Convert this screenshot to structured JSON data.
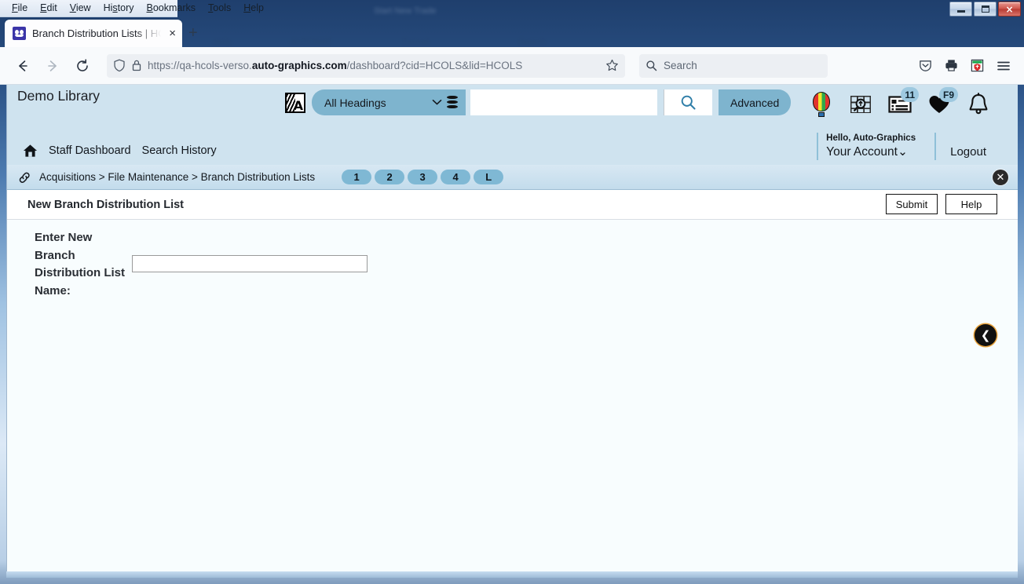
{
  "browser": {
    "menus": [
      "File",
      "Edit",
      "View",
      "History",
      "Bookmarks",
      "Tools",
      "Help"
    ],
    "window_controls": {
      "minimize": "minimize-button",
      "maximize": "maximize-button",
      "close": "×"
    },
    "tab": {
      "title": "Branch Distribution Lists | HCOLS",
      "close": "×",
      "favicon": "verso-favicon"
    },
    "new_tab": "+",
    "nav": {
      "back": "←",
      "forward": "→",
      "reload": "↻"
    },
    "url": {
      "prefix": "https://qa-hcols-verso.",
      "domain": "auto-graphics.com",
      "suffix": "/dashboard?cid=HCOLS&lid=HCOLS"
    },
    "bookmark_star": "☆",
    "search": {
      "placeholder": "Search"
    },
    "toolbar_icons": [
      "pocket-icon",
      "print-icon",
      "shield-extension-icon",
      "hamburger-menu-icon"
    ]
  },
  "app": {
    "brand": "Demo Library",
    "search": {
      "alpha_icon": "alphabetic-browse-icon",
      "scope_label": "All Headings",
      "chevron": "⌄",
      "database_icon": "database-icon",
      "query_value": "",
      "search_icon": "search-icon",
      "advanced_label": "Advanced"
    },
    "header_icons": [
      {
        "name": "balloon-icon",
        "badge": null
      },
      {
        "name": "map-search-icon",
        "badge": null
      },
      {
        "name": "list-records-icon",
        "badge": "11"
      },
      {
        "name": "favorites-heart-icon",
        "badge": "F9"
      },
      {
        "name": "notifications-bell-icon",
        "badge": null
      }
    ],
    "subnav": {
      "home_icon": "home-icon",
      "links": [
        "Staff Dashboard",
        "Search History"
      ],
      "hello": "Hello, Auto-Graphics",
      "account": "Your Account",
      "account_chevron": "⌄",
      "logout": "Logout"
    },
    "breadcrumb": {
      "link_icon": "chain-link-icon",
      "trail": "Acquisitions > File Maintenance > Branch Distribution Lists",
      "steps": [
        "1",
        "2",
        "3",
        "4",
        "L"
      ],
      "close": "✕"
    },
    "page": {
      "title": "New Branch Distribution List",
      "submit_label": "Submit",
      "help_label": "Help",
      "field_label": "Enter New Branch Distribution List Name:",
      "field_value": "",
      "field_placeholder": "",
      "back_arrow": "❮"
    },
    "colors": {
      "header_bg": "#cfe3ef",
      "accent": "#7eb4ce",
      "step_pill": "#7fb8d4",
      "content_bg": "#f8fdfe",
      "badge_bg": "#9ec9e0"
    }
  }
}
